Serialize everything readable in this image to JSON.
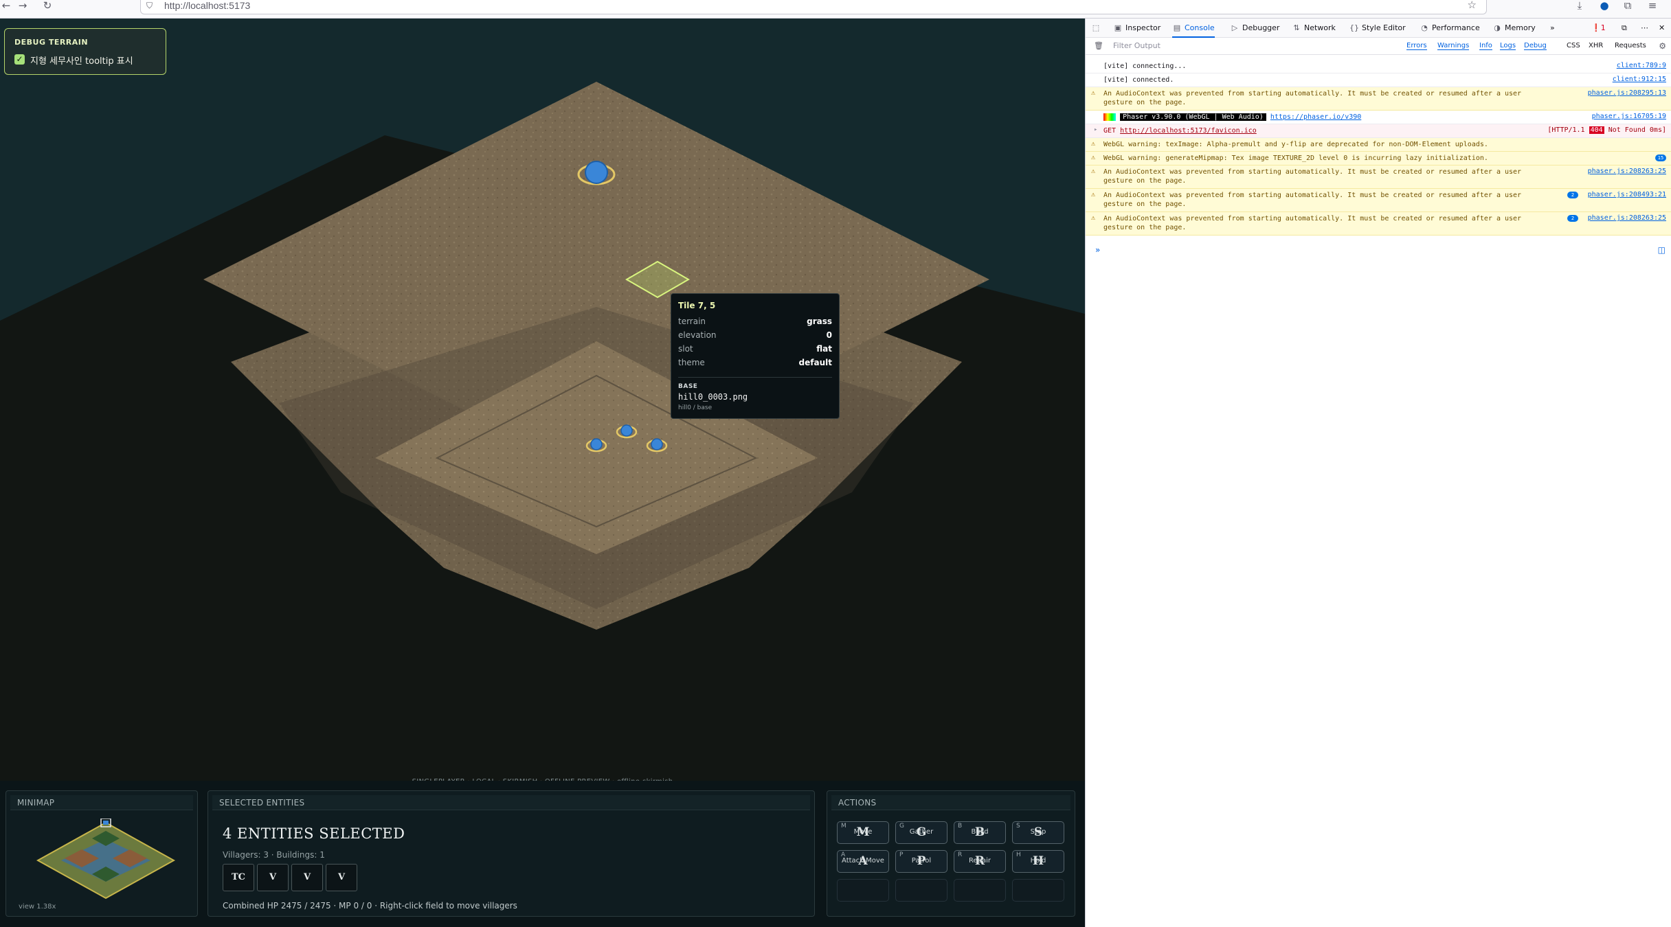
{
  "browser": {
    "url": "http://localhost:5173"
  },
  "debug": {
    "title": "DEBUG TERRAIN",
    "checkbox_label": "지형 세무사인 tooltip 표시",
    "checked": true
  },
  "tooltip": {
    "title": "Tile 7, 5",
    "rows": [
      {
        "key": "terrain",
        "value": "grass"
      },
      {
        "key": "elevation",
        "value": "0"
      },
      {
        "key": "slot",
        "value": "flat"
      },
      {
        "key": "theme",
        "value": "default"
      }
    ],
    "base_heading": "BASE",
    "base_file": "hill0_0003.png",
    "base_sub": "hill0 / base"
  },
  "hud": {
    "mode_line": "SINGLEPLAYER · LOCAL · SKIRMISH · OFFLINE PREVIEW · offline-skirmish",
    "minimap": {
      "title": "MINIMAP",
      "view": "view 1.38x"
    },
    "selected": {
      "title": "SELECTED ENTITIES",
      "count_text": "4 ENTITIES SELECTED",
      "subtext": "Villagers: 3 · Buildings: 1",
      "units": [
        "TC",
        "V",
        "V",
        "V"
      ],
      "footer": "Combined HP 2475 / 2475 · MP 0 / 0 · Right-click field to move villagers"
    },
    "actions": {
      "title": "ACTIONS",
      "buttons": [
        {
          "key": "M",
          "label": "Move",
          "glyph": "M"
        },
        {
          "key": "G",
          "label": "Gather",
          "glyph": "G"
        },
        {
          "key": "B",
          "label": "Build",
          "glyph": "B"
        },
        {
          "key": "S",
          "label": "Stop",
          "glyph": "S"
        },
        {
          "key": "A",
          "label": "Attack Move",
          "glyph": "A"
        },
        {
          "key": "P",
          "label": "Patrol",
          "glyph": "P"
        },
        {
          "key": "R",
          "label": "Repair",
          "glyph": "R"
        },
        {
          "key": "H",
          "label": "Hold",
          "glyph": "H"
        }
      ]
    }
  },
  "devtools": {
    "tabs": [
      {
        "label": "Inspector",
        "icon": "inspector-icon"
      },
      {
        "label": "Console",
        "icon": "console-icon"
      },
      {
        "label": "Debugger",
        "icon": "debugger-icon"
      },
      {
        "label": "Network",
        "icon": "network-icon"
      },
      {
        "label": "Style Editor",
        "icon": "style-editor-icon"
      },
      {
        "label": "Performance",
        "icon": "performance-icon"
      },
      {
        "label": "Memory",
        "icon": "memory-icon"
      }
    ],
    "error_count": "1",
    "filter_placeholder": "Filter Output",
    "filters": [
      "Errors",
      "Warnings",
      "Info",
      "Logs",
      "Debug",
      "CSS",
      "XHR",
      "Requests"
    ],
    "messages": [
      {
        "type": "log",
        "text": "[vite] connecting...",
        "source": "client:789:9"
      },
      {
        "type": "log",
        "text": "[vite] connected.",
        "source": "client:912:15"
      },
      {
        "type": "warn",
        "text": "An AudioContext was prevented from starting automatically. It must be created or resumed after a user gesture on the page.",
        "source": "phaser.js:208295:13"
      },
      {
        "type": "log",
        "text": "Phaser v3.90.0 (WebGL | Web Audio)",
        "link": "https://phaser.io/v390",
        "source": "phaser.js:16705:19"
      },
      {
        "type": "err",
        "method": "GET",
        "text": "http://localhost:5173/favicon.ico",
        "status_proto": "[HTTP/1.1",
        "status_code": "404",
        "status_text": "Not Found 0ms]"
      },
      {
        "type": "warn",
        "text": "WebGL warning: texImage: Alpha-premult and y-flip are deprecated for non-DOM-Element uploads.",
        "source": ""
      },
      {
        "type": "warn",
        "text": "WebGL warning: generateMipmap: Tex image TEXTURE_2D level 0 is incurring lazy initialization.",
        "source": "",
        "badge": "15"
      },
      {
        "type": "warn",
        "text": "An AudioContext was prevented from starting automatically. It must be created or resumed after a user gesture on the page.",
        "source": "phaser.js:208263:25"
      },
      {
        "type": "warn",
        "text": "An AudioContext was prevented from starting automatically. It must be created or resumed after a user gesture on the page.",
        "source": "phaser.js:208493:21",
        "badge": "2"
      },
      {
        "type": "warn",
        "text": "An AudioContext was prevented from starting automatically. It must be created or resumed after a user gesture on the page.",
        "source": "phaser.js:208263:25",
        "badge": "2"
      }
    ]
  }
}
